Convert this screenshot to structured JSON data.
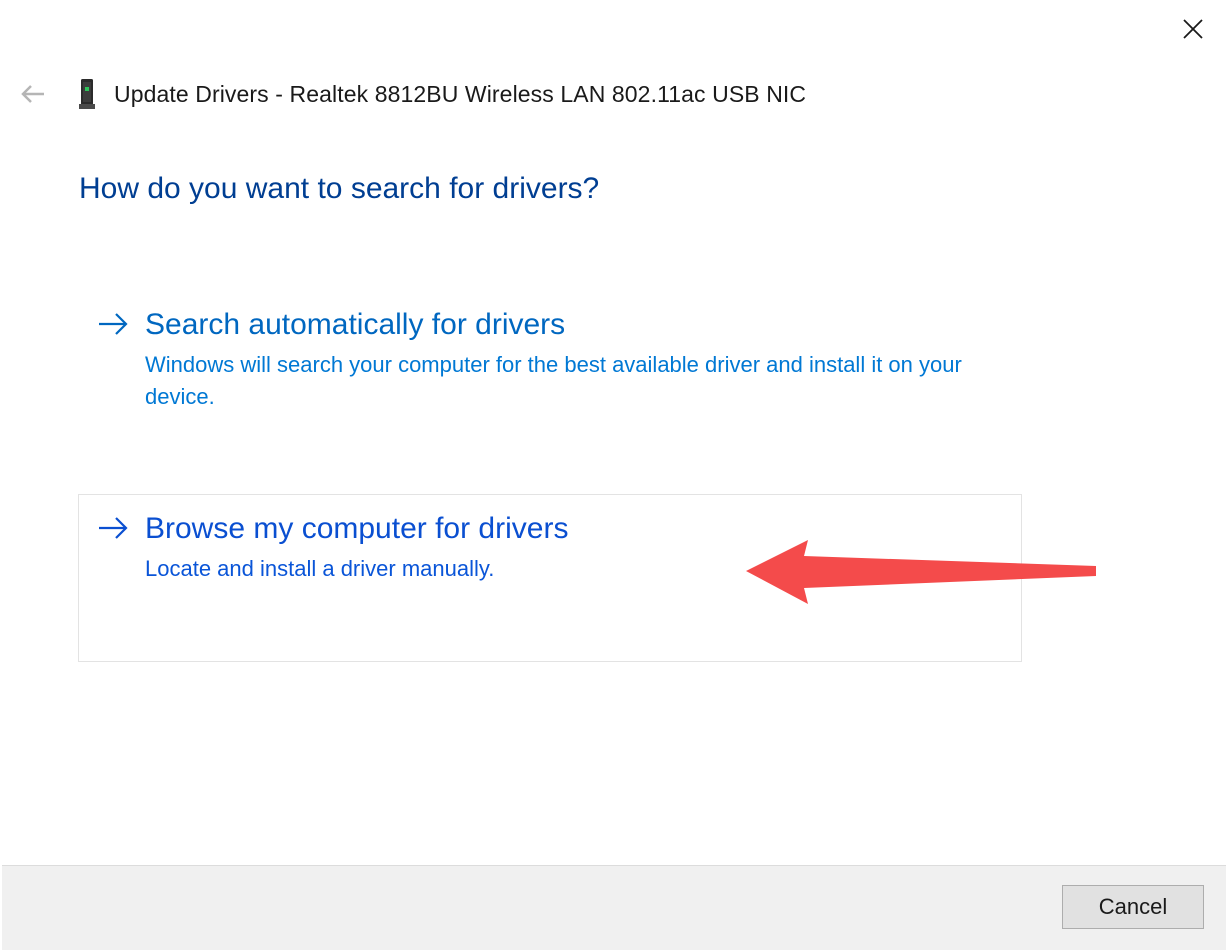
{
  "window": {
    "title": "Update Drivers - Realtek 8812BU Wireless LAN 802.11ac USB NIC"
  },
  "icons": {
    "close": "close-icon",
    "back": "back-arrow-icon",
    "device": "network-adapter-icon",
    "option_arrow": "right-arrow-icon",
    "callout": "red-pointer-arrow-icon"
  },
  "main": {
    "heading": "How do you want to search for drivers?",
    "options": [
      {
        "title": "Search automatically for drivers",
        "description": "Windows will search your computer for the best available driver and install it on your device."
      },
      {
        "title": "Browse my computer for drivers",
        "description": "Locate and install a driver manually."
      }
    ]
  },
  "footer": {
    "cancel_label": "Cancel"
  },
  "colors": {
    "heading": "#003e92",
    "link": "#0067c0",
    "callout": "#f44b4b",
    "footer_bg": "#f0f0f0"
  }
}
